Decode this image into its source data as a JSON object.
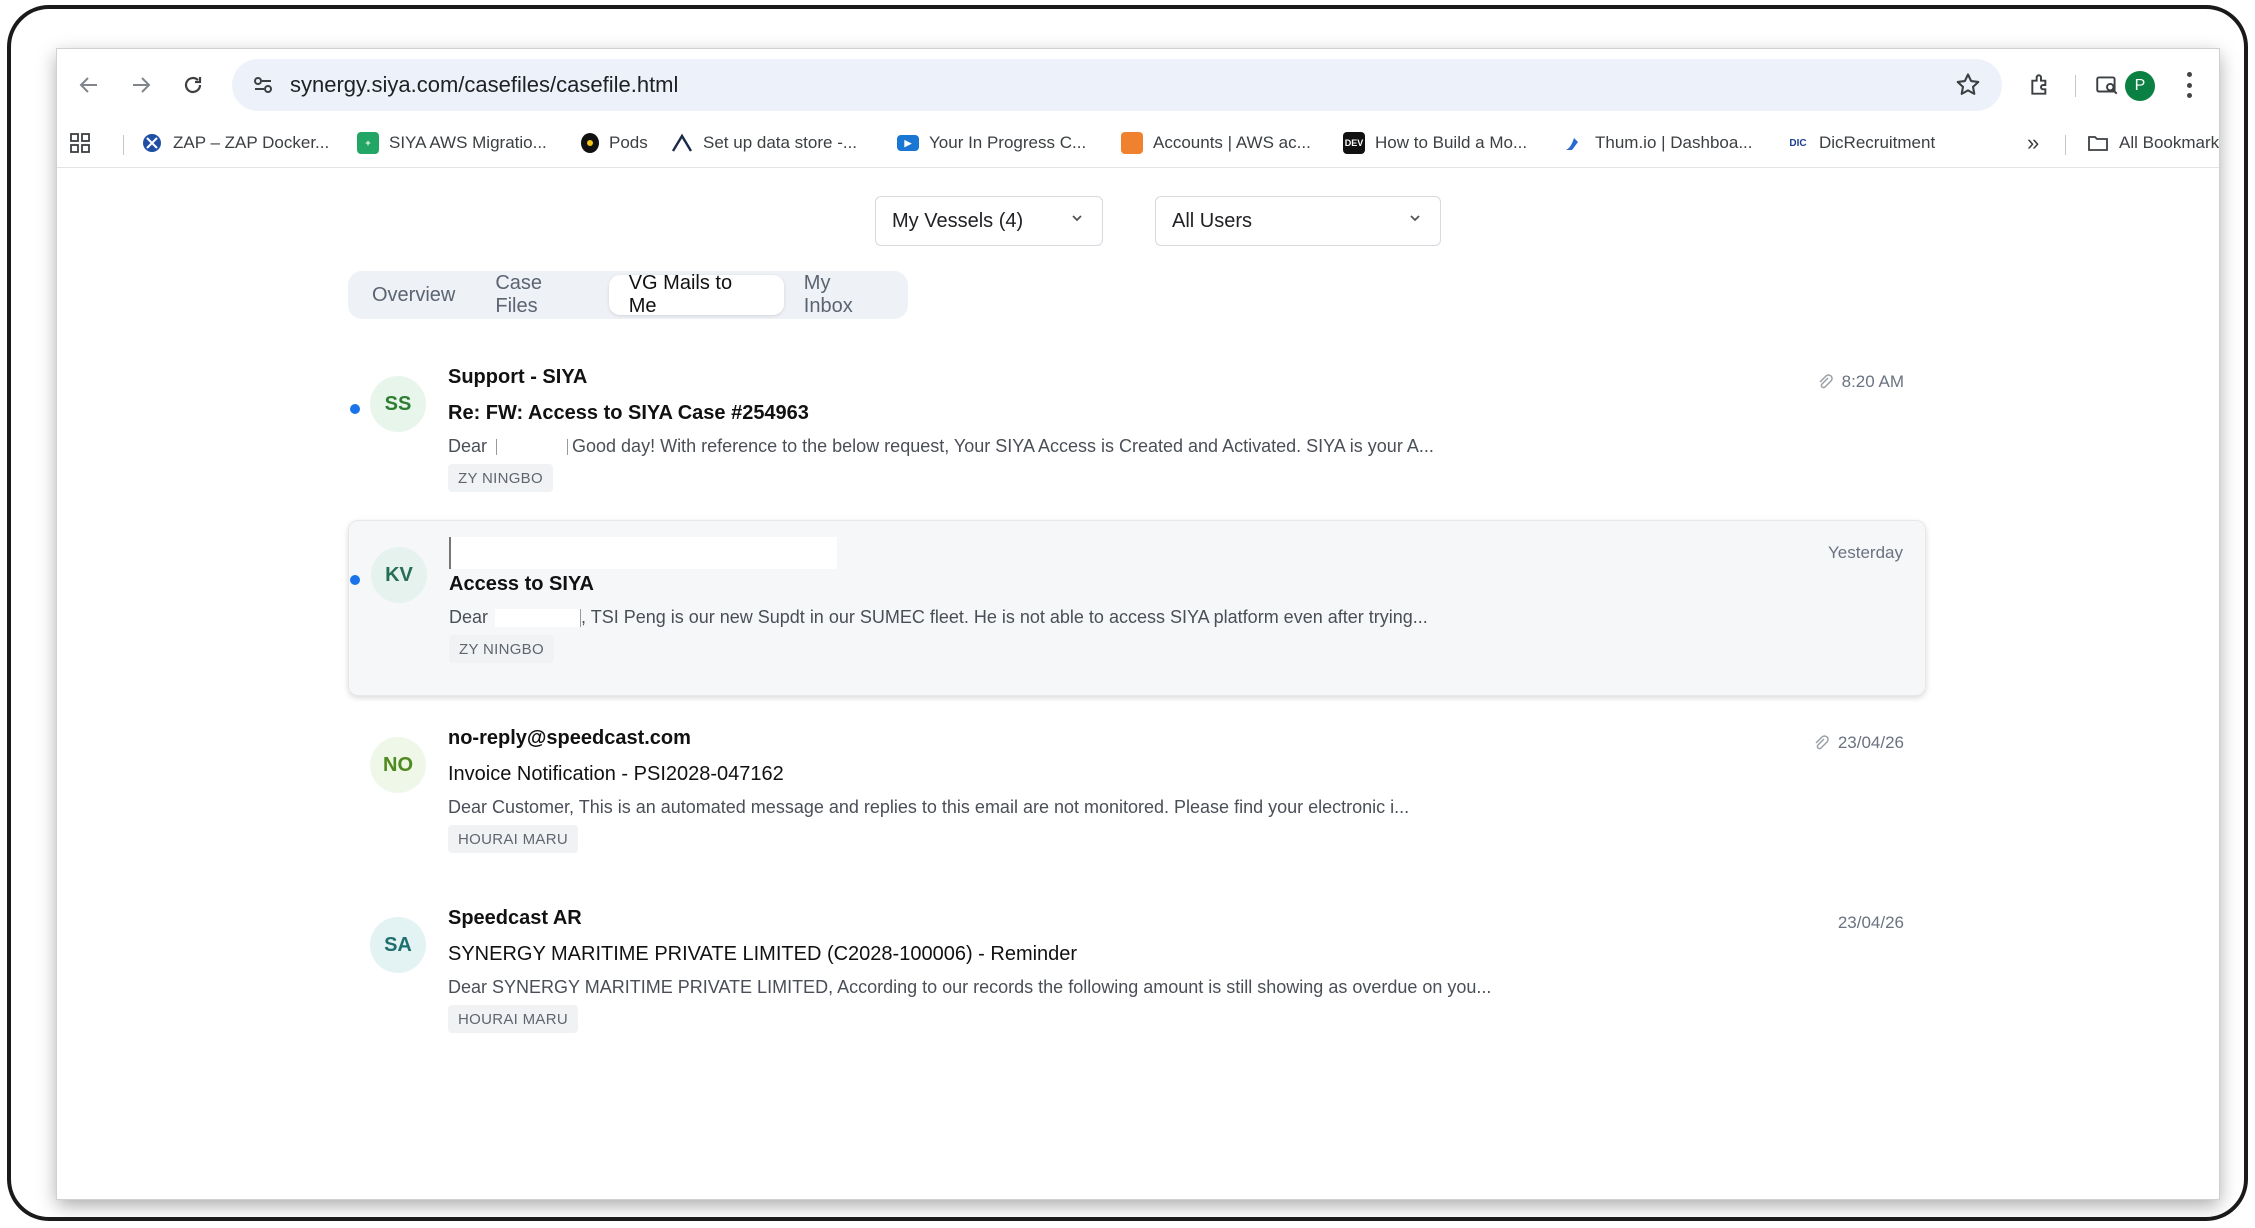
{
  "browser": {
    "url": "synergy.siya.com/casefiles/casefile.html",
    "profile_initial": "P",
    "bookmarks": [
      {
        "label": "ZAP – ZAP Docker..."
      },
      {
        "label": "SIYA AWS Migratio..."
      },
      {
        "label": "Pods"
      },
      {
        "label": "Set up data store -..."
      },
      {
        "label": "Your In Progress C..."
      },
      {
        "label": "Accounts | AWS ac..."
      },
      {
        "label": "How to Build a Mo..."
      },
      {
        "label": "Thum.io | Dashboa..."
      },
      {
        "label": "DicRecruitment"
      }
    ],
    "more_label": "»",
    "all_bookmarks": "All Bookmarks"
  },
  "filters": {
    "vessels": "My Vessels (4)",
    "users": "All Users"
  },
  "tabs": [
    {
      "label": "Overview"
    },
    {
      "label": "Case Files"
    },
    {
      "label": "VG Mails to Me"
    },
    {
      "label": "My Inbox"
    }
  ],
  "mails": [
    {
      "initials": "SS",
      "sender": "Support - SIYA",
      "subject": "Re: FW: Access to SIYA Case #254963",
      "preview_a": "Dear ",
      "preview_b": "Good day! With reference to the below request, Your SIYA Access is Created and Activated. SIYA is your A...",
      "tag": "ZY NINGBO",
      "time": "8:20 AM"
    },
    {
      "initials": "KV",
      "sender": "",
      "subject": "Access to SIYA",
      "preview_a": "Dear ",
      "preview_b": ", TSI Peng is our new Supdt in our SUMEC fleet. He is not able to access SIYA platform even after trying...",
      "tag": "ZY NINGBO",
      "time": "Yesterday"
    },
    {
      "initials": "NO",
      "sender": "no-reply@speedcast.com",
      "subject": "Invoice Notification - PSI2028-047162",
      "preview_a": "Dear Customer, This is an automated message and replies to this email are not monitored. Please find your electronic i...",
      "preview_b": "",
      "tag": "HOURAI MARU",
      "time": "23/04/26"
    },
    {
      "initials": "SA",
      "sender": "Speedcast AR",
      "subject": "SYNERGY MARITIME PRIVATE LIMITED (C2028-100006) - Reminder",
      "preview_a": "Dear SYNERGY MARITIME PRIVATE LIMITED, According to our records the following amount is still showing as overdue on you...",
      "preview_b": "",
      "tag": "HOURAI MARU",
      "time": "23/04/26"
    }
  ]
}
